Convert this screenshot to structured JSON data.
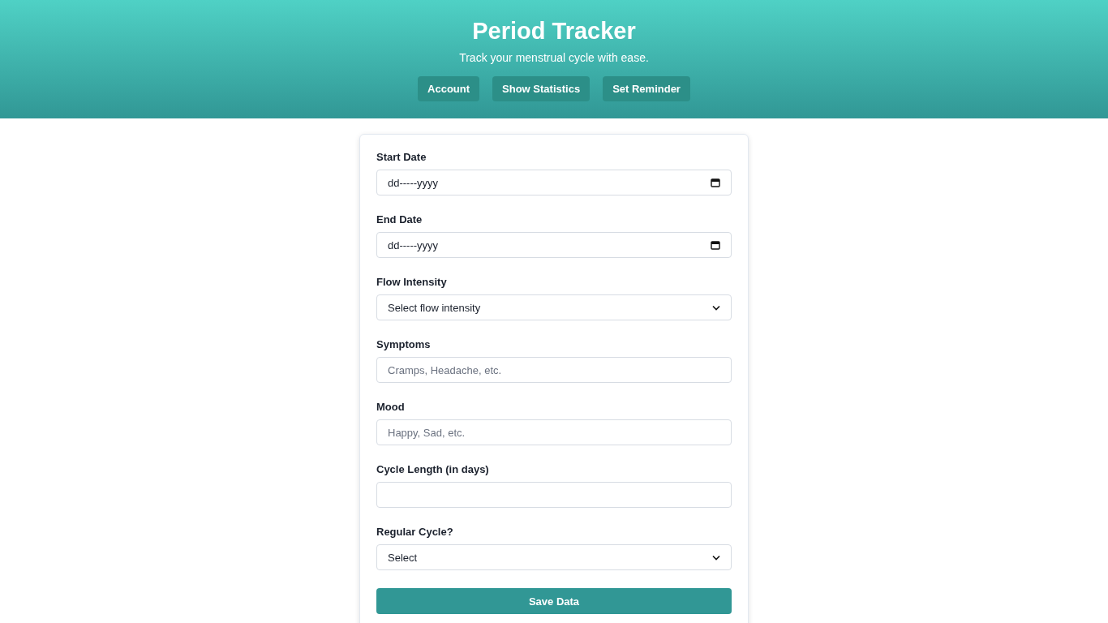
{
  "header": {
    "title": "Period Tracker",
    "subtitle": "Track your menstrual cycle with ease.",
    "buttons": [
      "Account",
      "Show Statistics",
      "Set Reminder"
    ]
  },
  "form": {
    "fields": [
      {
        "kind": "date",
        "label": "Start Date",
        "value": "dd-----yyyy"
      },
      {
        "kind": "date",
        "label": "End Date",
        "value": "dd-----yyyy"
      },
      {
        "kind": "select",
        "label": "Flow Intensity",
        "value": "Select flow intensity"
      },
      {
        "kind": "text",
        "label": "Symptoms",
        "placeholder": "Cramps, Headache, etc."
      },
      {
        "kind": "text",
        "label": "Mood",
        "placeholder": "Happy, Sad, etc."
      },
      {
        "kind": "number",
        "label": "Cycle Length (in days)"
      },
      {
        "kind": "select",
        "label": "Regular Cycle?",
        "value": "Select"
      }
    ],
    "submit": "Save Data"
  }
}
